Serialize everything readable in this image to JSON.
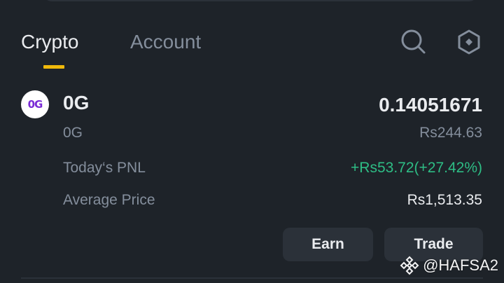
{
  "tabs": [
    {
      "label": "Crypto",
      "active": true
    },
    {
      "label": "Account",
      "active": false
    }
  ],
  "icons": {
    "search": "search-icon",
    "settings": "hexagon-settings-icon"
  },
  "asset": {
    "logo_text": "0G",
    "symbol": "0G",
    "name": "0G",
    "balance": "0.14051671",
    "fiat_value": "Rs244.63",
    "pnl_label": "Today‘s PNL",
    "pnl_value": "+Rs53.72(+27.42%)",
    "avg_label": "Average Price",
    "avg_value": "Rs1,513.35"
  },
  "actions": {
    "earn": "Earn",
    "trade": "Trade"
  },
  "watermark": "@HAFSA2",
  "colors": {
    "background": "#1e2329",
    "accent": "#f0b90b",
    "positive": "#2ebd85",
    "muted": "#848e9c",
    "text": "#eaecef",
    "button": "#2b3139"
  }
}
